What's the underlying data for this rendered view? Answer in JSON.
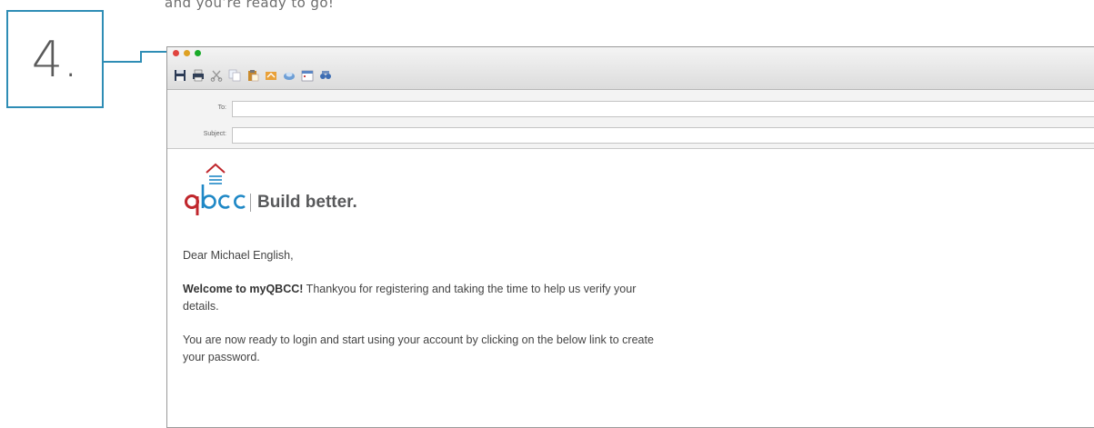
{
  "intro": {
    "text": "and you’re ready to go!"
  },
  "step": {
    "number": "4."
  },
  "colors": {
    "accent": "#2e8db5",
    "brand_red": "#c0272d",
    "brand_blue": "#1f88c6"
  },
  "window": {
    "traffic_lights": [
      "close",
      "minimize",
      "maximize"
    ],
    "toolbar_icons": [
      "save-icon",
      "print-icon",
      "cut-icon",
      "copy-icon",
      "paste-icon",
      "undo-icon",
      "attach-icon",
      "calendar-icon",
      "address-book-icon"
    ]
  },
  "header": {
    "to_label": "To:",
    "to_value": "",
    "subject_label": "Subject:",
    "subject_value": ""
  },
  "email": {
    "logo_wordmark": "qbcc",
    "logo_tagline": "Build better.",
    "greeting": "Dear Michael English,",
    "welcome_bold": "Welcome to myQBCC!",
    "welcome_rest": " Thankyou for registering and taking the time to help us verify your details.",
    "instructions": "You are now ready to login and start using your account by clicking on the below link to create your password."
  }
}
